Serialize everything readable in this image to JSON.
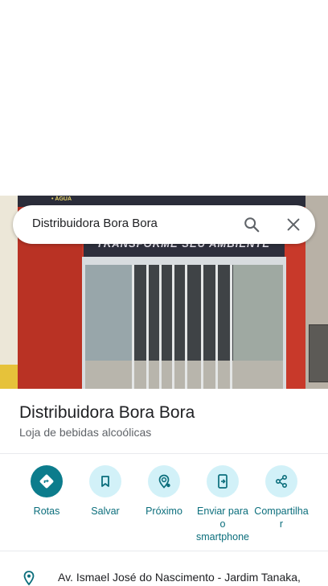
{
  "search": {
    "query": "Distribuidora Bora Bora"
  },
  "photo": {
    "sign_top": "• ÁGUA",
    "banner": "TRANSFORME SEU AMBIENTE"
  },
  "place": {
    "title": "Distribuidora Bora Bora",
    "category": "Loja de bebidas alcoólicas",
    "address": "Av. Ismael José do Nascimento - Jardim Tanaka,"
  },
  "actions": [
    {
      "label": "Rotas",
      "icon": "directions-icon"
    },
    {
      "label": "Salvar",
      "icon": "bookmark-icon"
    },
    {
      "label": "Próximo",
      "icon": "nearby-icon"
    },
    {
      "label": "Enviar para\no\nsmartphone",
      "icon": "send-to-phone-icon"
    },
    {
      "label": "Compartilha\nr",
      "icon": "share-icon"
    }
  ],
  "colors": {
    "accent": "#0c7c8c",
    "accent_light": "#d2f1f8",
    "label": "#0b6e7c"
  }
}
